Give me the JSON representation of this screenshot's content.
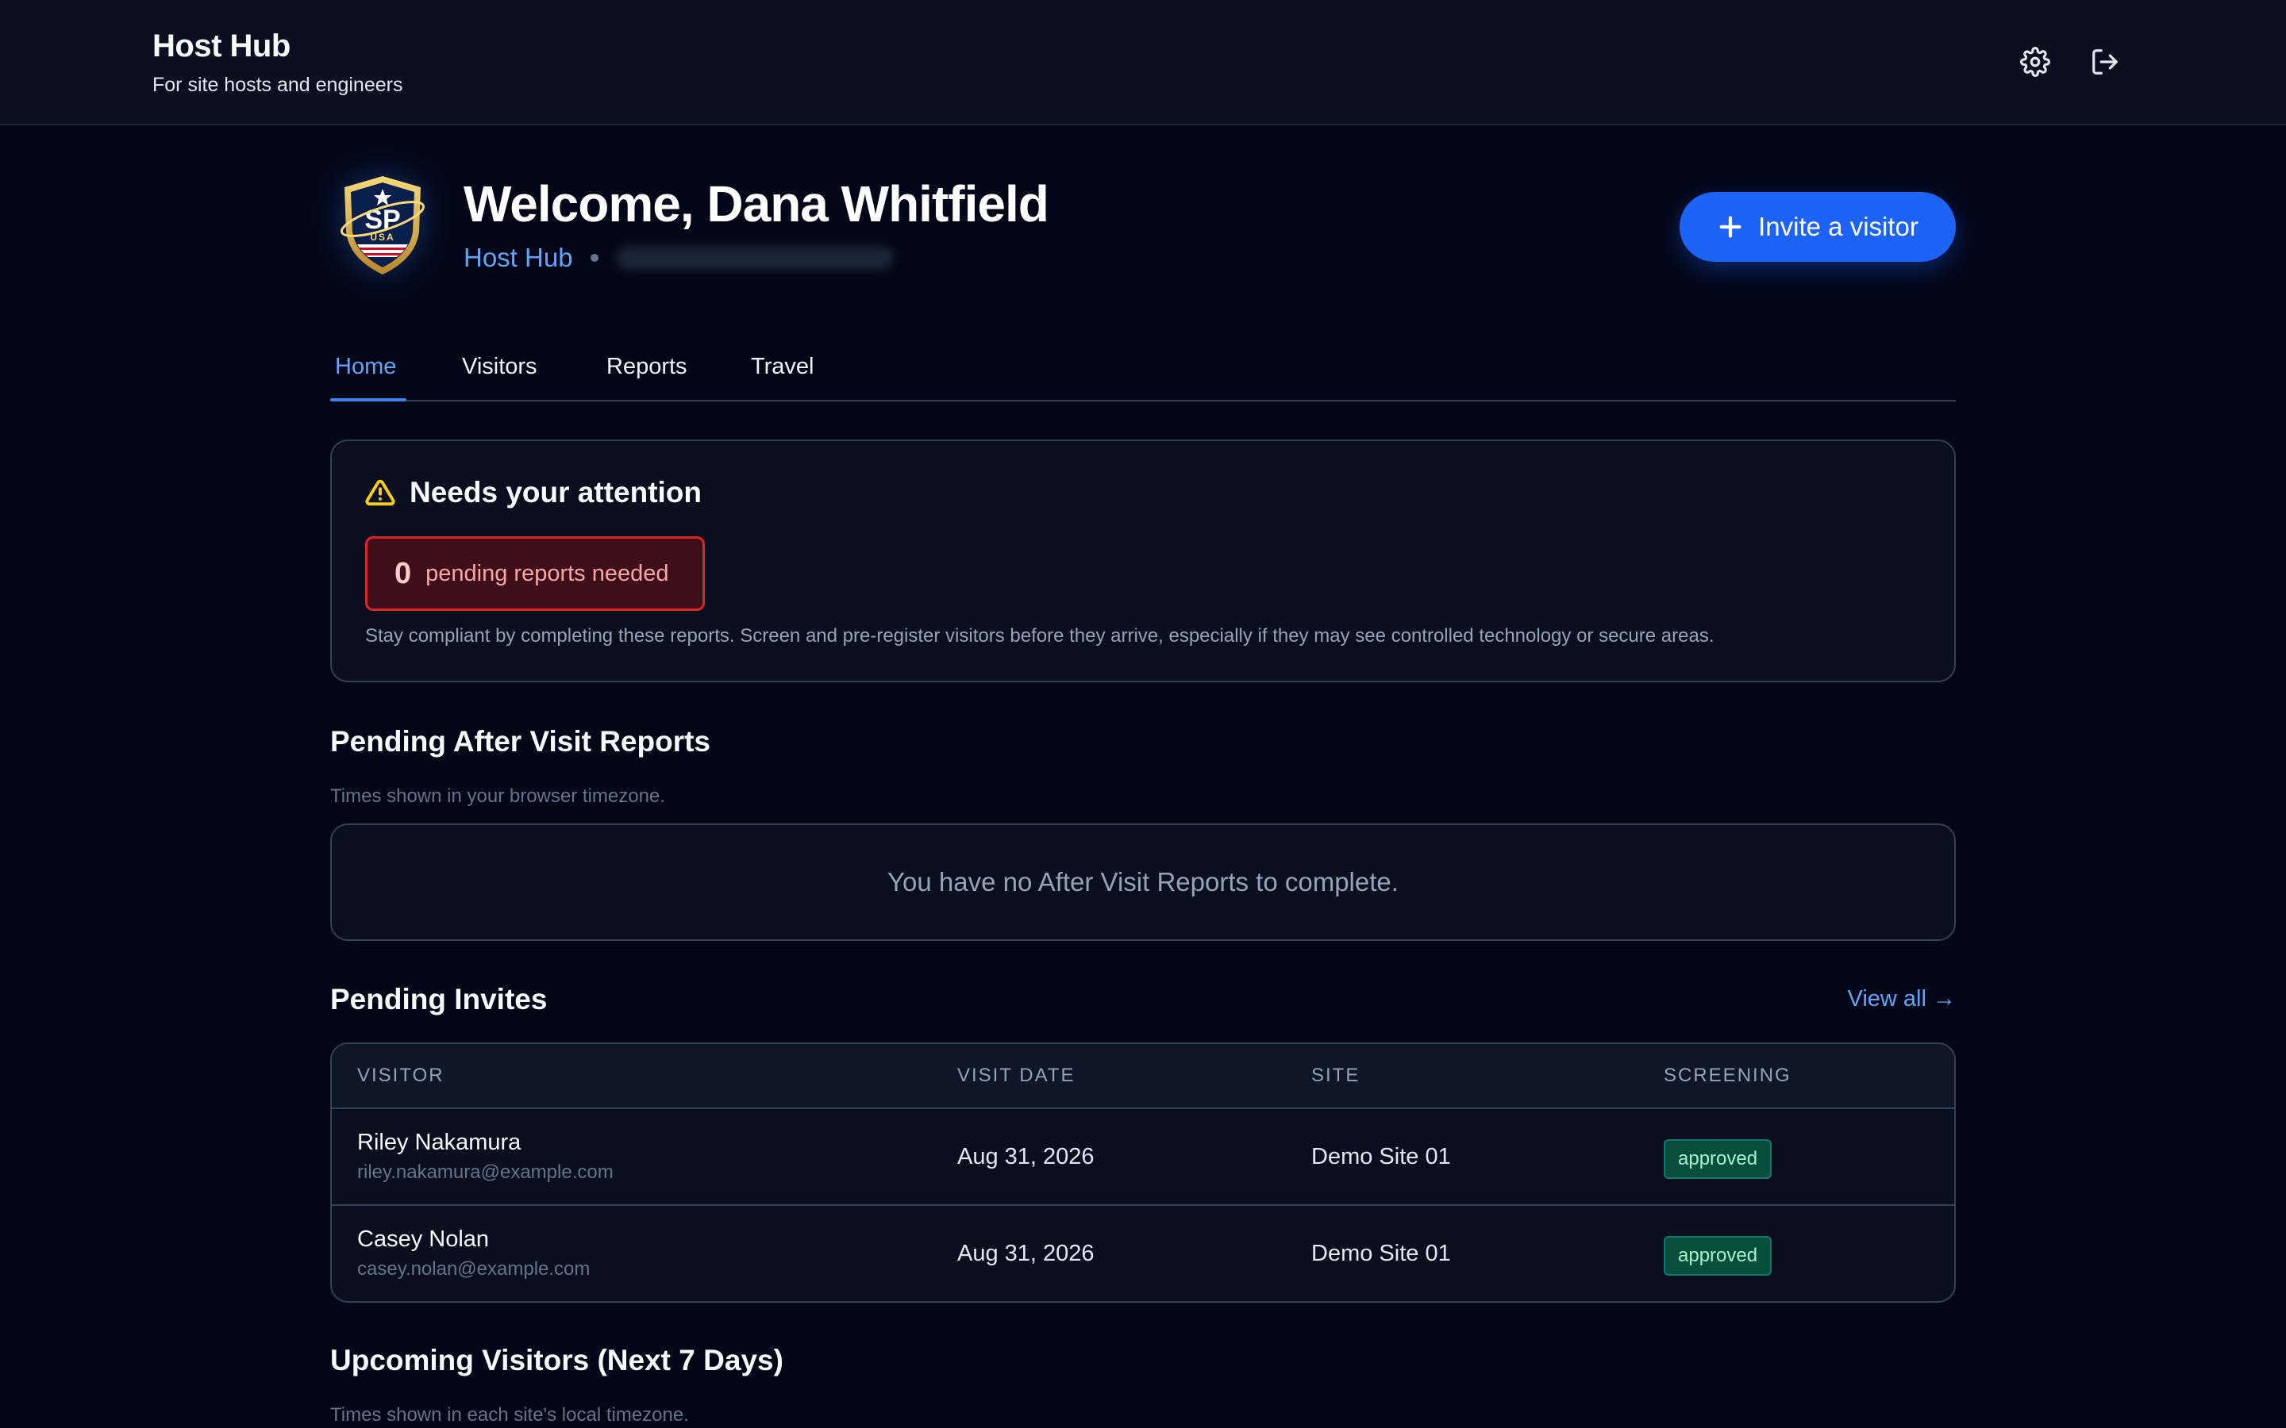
{
  "header": {
    "title": "Host Hub",
    "subtitle": "For site hosts and engineers",
    "icons": [
      "gear-icon",
      "logout-icon"
    ]
  },
  "hero": {
    "welcome": "Welcome, Dana Whitfield",
    "hub_label": "Host Hub",
    "logo": {
      "letters": "SP",
      "country": "USA"
    },
    "invite_button": "Invite a visitor"
  },
  "tabs": [
    {
      "label": "Home",
      "active": true
    },
    {
      "label": "Visitors",
      "active": false
    },
    {
      "label": "Reports",
      "active": false
    },
    {
      "label": "Travel",
      "active": false
    }
  ],
  "attention": {
    "title": "Needs your attention",
    "pending_count": "0",
    "pending_label": "pending reports needed",
    "note": "Stay compliant by completing these reports. Screen and pre-register visitors before they arrive, especially if they may see controlled technology or secure areas."
  },
  "after_visit": {
    "title": "Pending After Visit Reports",
    "note": "Times shown in your browser timezone.",
    "empty": "You have no After Visit Reports to complete."
  },
  "pending_invites": {
    "title": "Pending Invites",
    "view_all": "View all →",
    "columns": [
      "VISITOR",
      "VISIT DATE",
      "SITE",
      "SCREENING"
    ],
    "rows": [
      {
        "name": "Riley Nakamura",
        "email": "riley.nakamura@example.com",
        "date": "Aug 31, 2026",
        "site": "Demo Site 01",
        "screening": "approved"
      },
      {
        "name": "Casey Nolan",
        "email": "casey.nolan@example.com",
        "date": "Aug 31, 2026",
        "site": "Demo Site 01",
        "screening": "approved"
      }
    ]
  },
  "upcoming": {
    "title": "Upcoming Visitors (Next 7 Days)",
    "note": "Times shown in each site's local timezone."
  },
  "colors": {
    "background": "#020617",
    "accent": "#1d63f5",
    "link": "#60a5fa",
    "alert": "#dc2626",
    "success": "#064e3b"
  }
}
